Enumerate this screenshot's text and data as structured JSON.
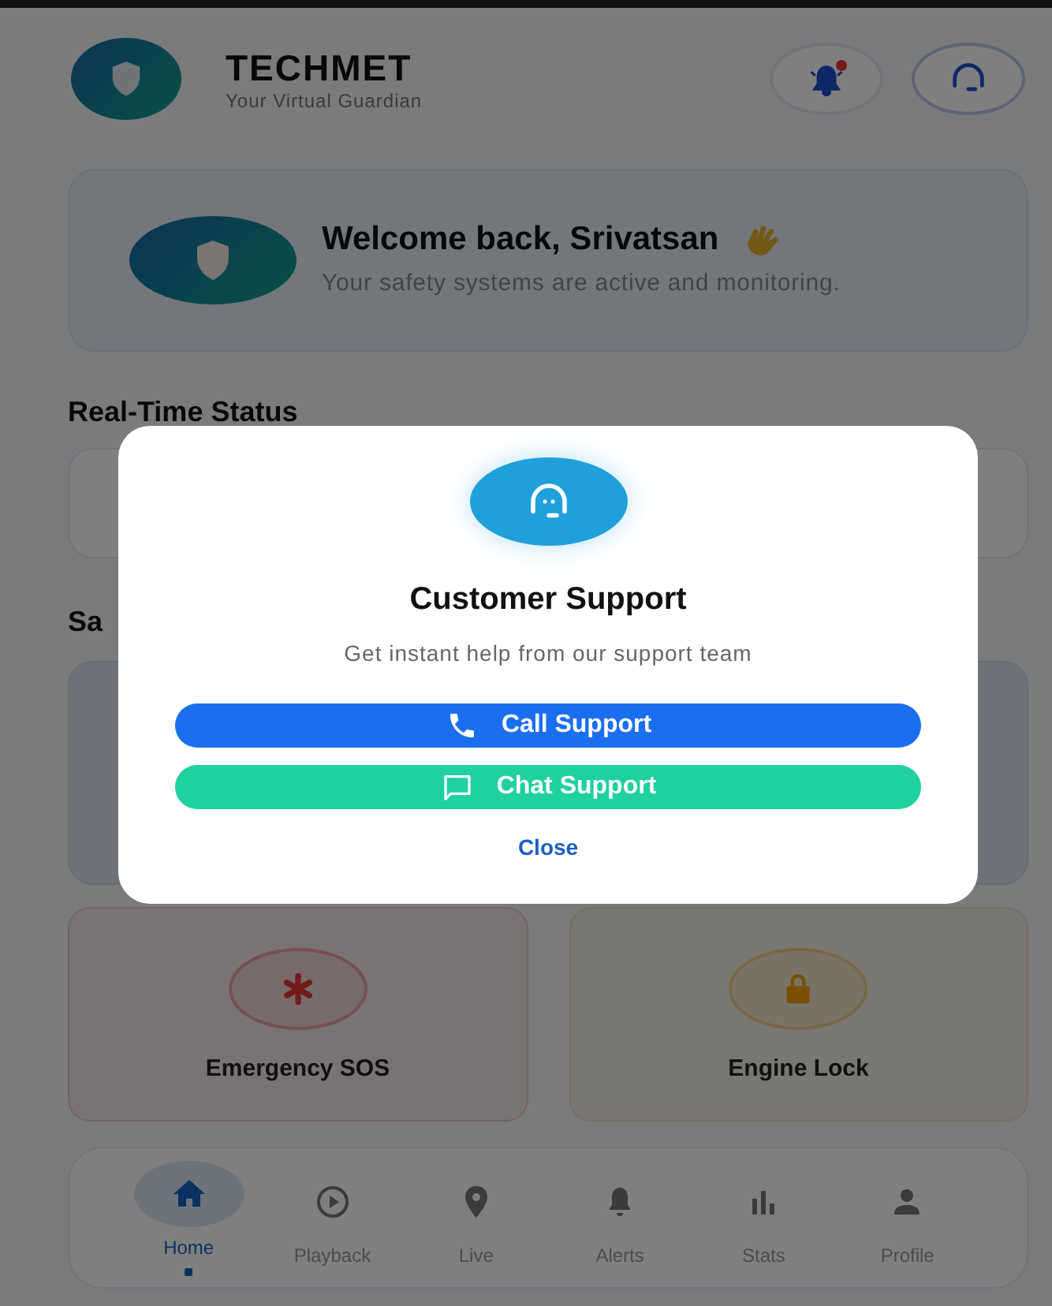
{
  "header": {
    "title": "TECHMET",
    "subtitle": "Your Virtual Guardian",
    "notification_badge": true
  },
  "welcome": {
    "title": "Welcome back, Srivatsan",
    "text": "Your safety systems are active and monitoring."
  },
  "sections": [
    {
      "title": "Real-Time Status"
    },
    {
      "title": "Sa"
    }
  ],
  "actions": [
    {
      "label": "Emergency SOS",
      "kind": "sos"
    },
    {
      "label": "Engine Lock",
      "kind": "lock"
    }
  ],
  "nav": [
    {
      "label": "Home",
      "kind": "home",
      "selected": true
    },
    {
      "label": "Playback",
      "kind": "play",
      "selected": false
    },
    {
      "label": "Live",
      "kind": "pin",
      "selected": false
    },
    {
      "label": "Alerts",
      "kind": "bell",
      "selected": false
    },
    {
      "label": "Stats",
      "kind": "chart",
      "selected": false
    },
    {
      "label": "Profile",
      "kind": "person",
      "selected": false
    }
  ],
  "modal": {
    "title": "Customer Support",
    "text": "Get instant help from our support team",
    "buttons": [
      {
        "label": "Call Support",
        "kind": "call"
      },
      {
        "label": "Chat Support",
        "kind": "chat"
      }
    ],
    "close": "Close"
  }
}
